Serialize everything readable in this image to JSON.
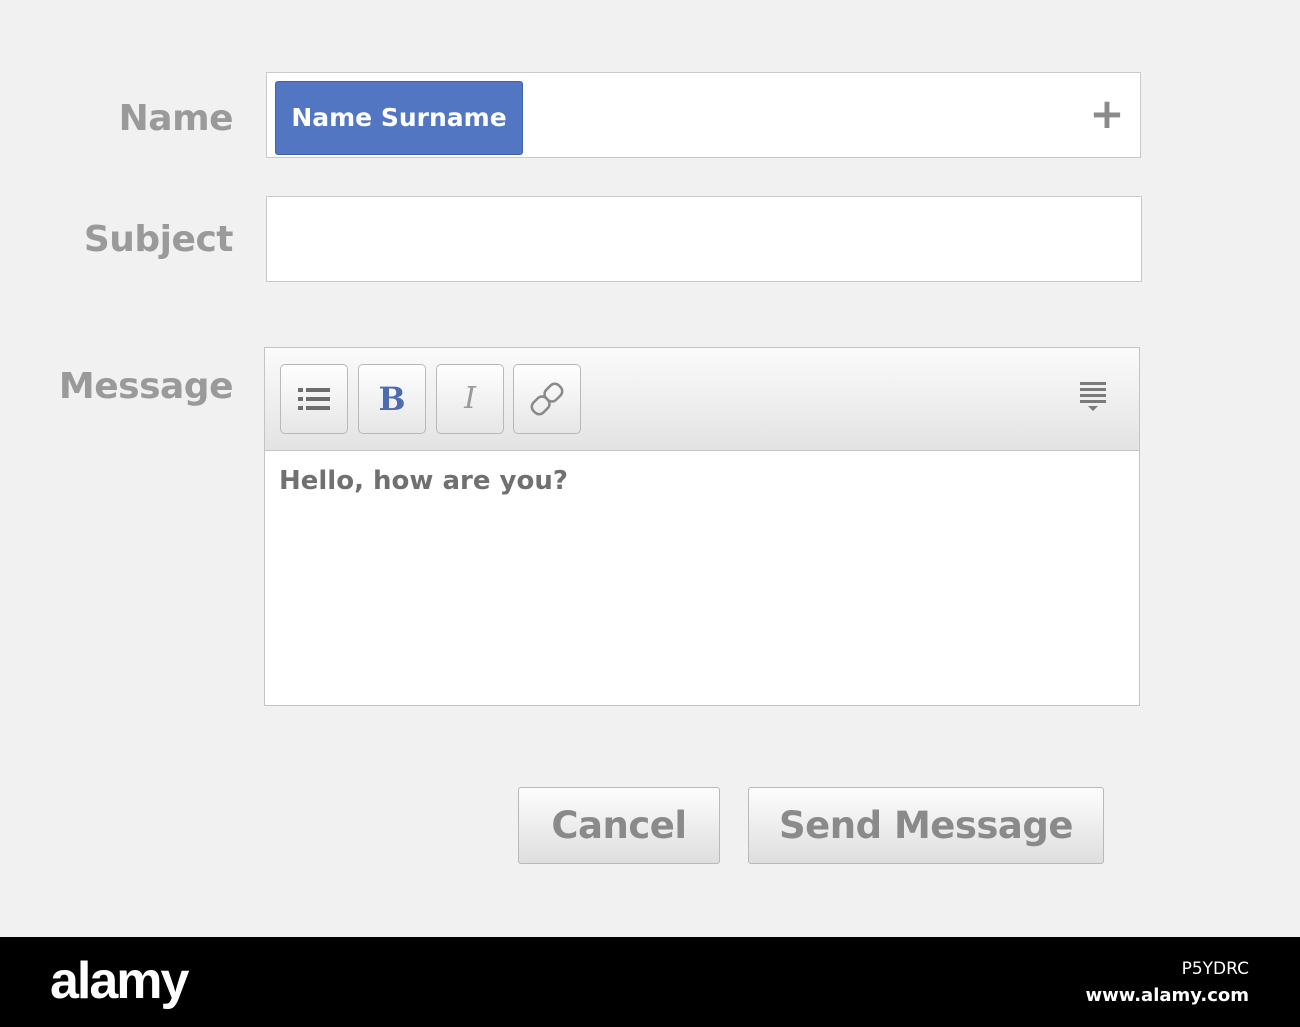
{
  "form": {
    "name_label": "Name",
    "subject_label": "Subject",
    "message_label": "Message",
    "recipient_chip": "Name Surname",
    "add_icon": "plus-icon",
    "subject_value": "",
    "message_text": "Hello, how are you?"
  },
  "toolbar": {
    "buttons": [
      "list-icon",
      "bold-icon",
      "italic-icon",
      "link-icon"
    ],
    "bold_glyph": "B",
    "italic_glyph": "I",
    "menu_icon": "menu-dropdown-icon"
  },
  "actions": {
    "cancel_label": "Cancel",
    "send_label": "Send Message"
  },
  "footer": {
    "logo_text": "alamy",
    "image_code": "P5YDRC",
    "url": "www.alamy.com"
  },
  "colors": {
    "chip_blue": "#5276c2",
    "bold_blue": "#4c6bb0",
    "label_gray": "#9a9a9a",
    "background": "#f1f1f1"
  }
}
